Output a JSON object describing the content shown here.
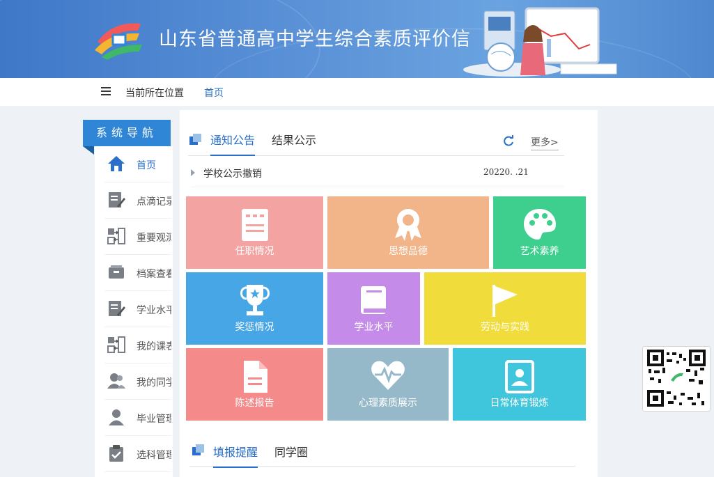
{
  "header": {
    "site_title": "山东省普通高中学生综合素质评价信"
  },
  "breadcrumb": {
    "label": "当前所在位置",
    "current": "首页"
  },
  "sidebar": {
    "title": "系统导航",
    "items": [
      {
        "label": "首页",
        "icon": "home-icon"
      },
      {
        "label": "点滴记录",
        "icon": "edit-icon"
      },
      {
        "label": "重要观测",
        "icon": "swap-icon"
      },
      {
        "label": "档案查看",
        "icon": "archive-icon"
      },
      {
        "label": "学业水平",
        "icon": "edit-icon"
      },
      {
        "label": "我的课表",
        "icon": "swap-icon"
      },
      {
        "label": "我的同学",
        "icon": "users-icon"
      },
      {
        "label": "毕业管理",
        "icon": "user-icon"
      },
      {
        "label": "选科管理",
        "icon": "clipboard-icon"
      }
    ]
  },
  "notices": {
    "tabs": [
      "通知公告",
      "结果公示"
    ],
    "more": "更多>",
    "items": [
      {
        "title": "学校公示撤销",
        "date": "20220.   .21"
      }
    ]
  },
  "tiles": [
    {
      "label": "任职情况",
      "color": "#f4a3a3",
      "icon": "notebook-icon"
    },
    {
      "label": "思想品德",
      "color": "#f2b58a",
      "icon": "badge-icon"
    },
    {
      "label": "艺术素养",
      "color": "#3ecf8e",
      "icon": "palette-icon"
    },
    {
      "label": "奖惩情况",
      "color": "#47a6e6",
      "icon": "trophy-icon"
    },
    {
      "label": "学业水平",
      "color": "#c58be8",
      "icon": "book-icon"
    },
    {
      "label": "劳动与实践",
      "color": "#f0dc3a",
      "icon": "flag-icon"
    },
    {
      "label": "陈述报告",
      "color": "#f48a8a",
      "icon": "document-icon"
    },
    {
      "label": "心理素质展示",
      "color": "#95b9c9",
      "icon": "heart-icon"
    },
    {
      "label": "日常体育锻炼",
      "color": "#3fc6dc",
      "icon": "id-card-icon"
    }
  ],
  "reminders": {
    "tabs": [
      "填报提醒",
      "同学圈"
    ]
  }
}
